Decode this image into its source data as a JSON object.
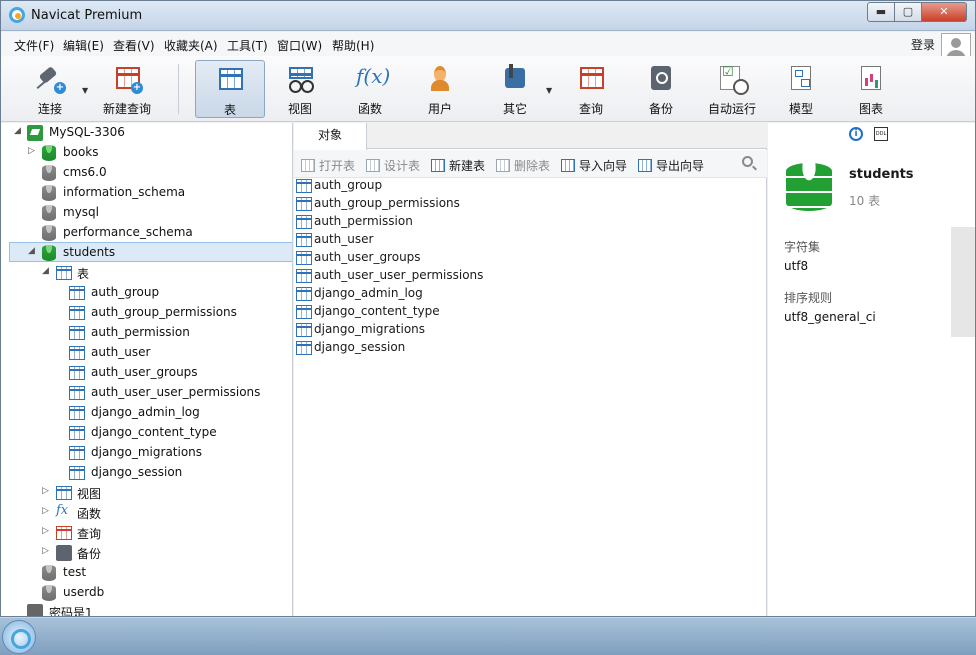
{
  "window": {
    "title": "Navicat Premium",
    "controls": {
      "minimize": "▬",
      "maximize": "▢",
      "close": "✕"
    }
  },
  "menu": {
    "items": [
      "文件(F)",
      "编辑(E)",
      "查看(V)",
      "收藏夹(A)",
      "工具(T)",
      "窗口(W)",
      "帮助(H)"
    ],
    "login": "登录"
  },
  "toolbar": {
    "buttons": [
      {
        "label": "连接",
        "icon": "plug-icon"
      },
      {
        "label": "新建查询",
        "icon": "new-query-icon"
      },
      {
        "label": "表",
        "icon": "table-icon",
        "active": true
      },
      {
        "label": "视图",
        "icon": "view-icon"
      },
      {
        "label": "函数",
        "icon": "function-icon"
      },
      {
        "label": "用户",
        "icon": "user-icon"
      },
      {
        "label": "其它",
        "icon": "tools-icon"
      },
      {
        "label": "查询",
        "icon": "query-icon"
      },
      {
        "label": "备份",
        "icon": "backup-icon"
      },
      {
        "label": "自动运行",
        "icon": "auto-run-icon"
      },
      {
        "label": "模型",
        "icon": "model-icon"
      },
      {
        "label": "图表",
        "icon": "chart-icon"
      }
    ],
    "fx_glyph": "f(x)"
  },
  "tree": {
    "connection": "MySQL-3306",
    "databases": [
      "books",
      "cms6.0",
      "information_schema",
      "mysql",
      "performance_schema",
      "students"
    ],
    "tables_folder": "表",
    "tables": [
      "auth_group",
      "auth_group_permissions",
      "auth_permission",
      "auth_user",
      "auth_user_groups",
      "auth_user_user_permissions",
      "django_admin_log",
      "django_content_type",
      "django_migrations",
      "django_session"
    ],
    "folders": [
      "视图",
      "函数",
      "查询",
      "备份"
    ],
    "fx_glyph": "fx",
    "other_databases": [
      "test",
      "userdb"
    ],
    "other_connection": "密码是1"
  },
  "objects": {
    "tab": "对象",
    "actions": {
      "open": "打开表",
      "design": "设计表",
      "new": "新建表",
      "delete": "删除表",
      "import": "导入向导",
      "export": "导出向导"
    },
    "items": [
      "auth_group",
      "auth_group_permissions",
      "auth_permission",
      "auth_user",
      "auth_user_groups",
      "auth_user_user_permissions",
      "django_admin_log",
      "django_content_type",
      "django_migrations",
      "django_session"
    ]
  },
  "info": {
    "info_glyph": "i",
    "ddl_glyph": "DDL",
    "db_name": "students",
    "table_count": "10 表",
    "charset_label": "字符集",
    "charset_value": "utf8",
    "collation_label": "排序规则",
    "collation_value": "utf8_general_ci"
  }
}
